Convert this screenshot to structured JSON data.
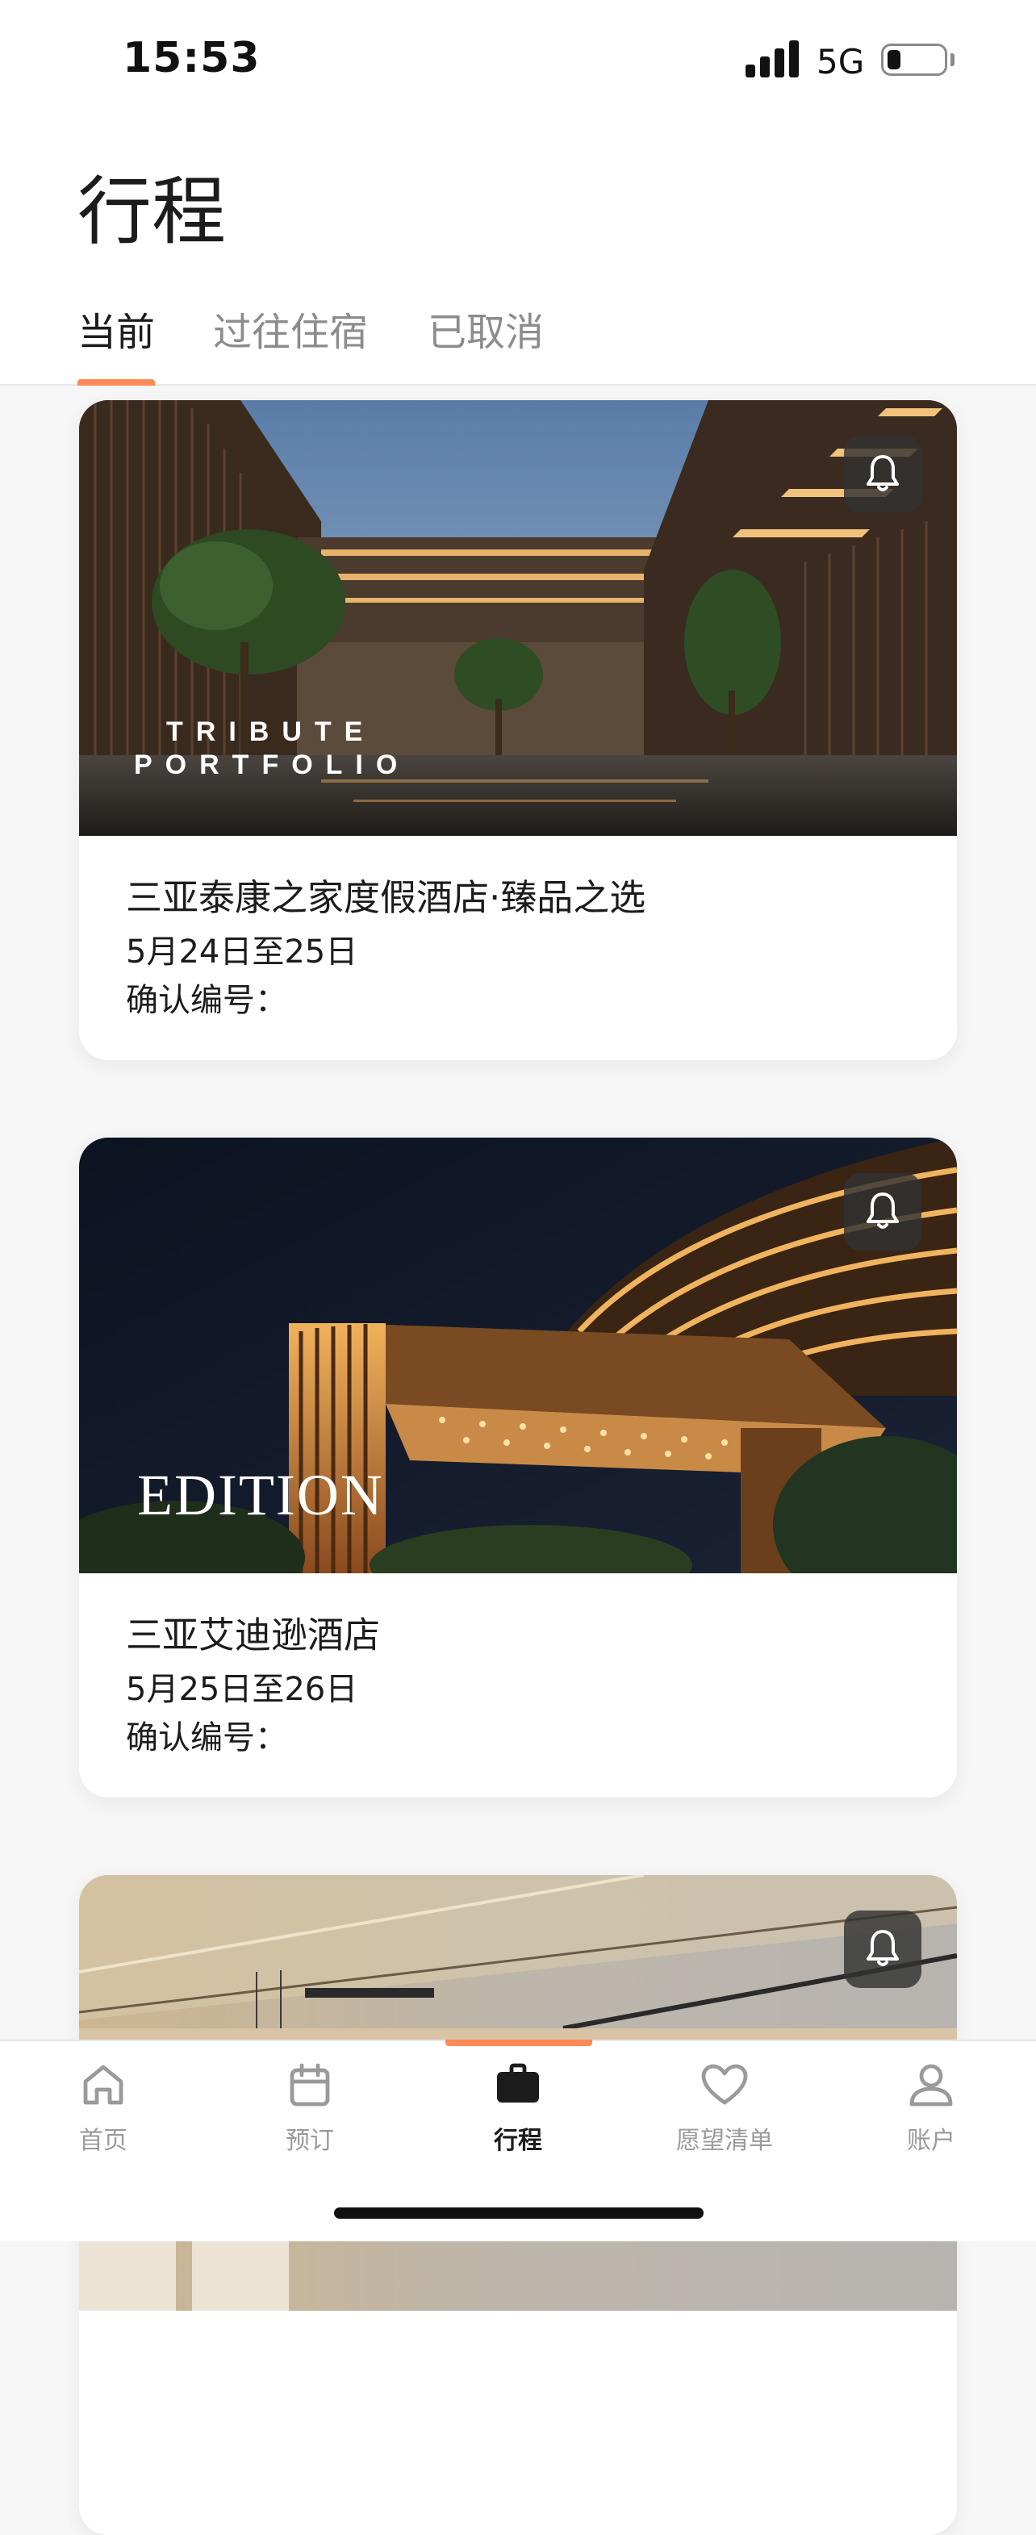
{
  "status_bar": {
    "time": "15:53",
    "network": "5G"
  },
  "header": {
    "title": "行程",
    "tabs": [
      {
        "label": "当前",
        "active": true
      },
      {
        "label": "过往住宿",
        "active": false
      },
      {
        "label": "已取消",
        "active": false
      }
    ]
  },
  "trips": [
    {
      "brand_logo_lines": [
        "TRIBUTE",
        "PORTFOLIO"
      ],
      "hotel_name": "三亚泰康之家度假酒店·臻品之选",
      "dates": "5月24日至25日",
      "confirmation_label": "确认编号："
    },
    {
      "brand_logo_lines": [
        "EDITION"
      ],
      "hotel_name": "三亚艾迪逊酒店",
      "dates": "5月25日至26日",
      "confirmation_label": "确认编号："
    },
    {
      "hotel_name": "",
      "dates": "",
      "confirmation_label": ""
    }
  ],
  "bottom_nav": {
    "items": [
      {
        "label": "首页",
        "icon": "home-icon",
        "active": false
      },
      {
        "label": "预订",
        "icon": "calendar-icon",
        "active": false
      },
      {
        "label": "行程",
        "icon": "briefcase-icon",
        "active": true
      },
      {
        "label": "愿望清单",
        "icon": "heart-icon",
        "active": false
      },
      {
        "label": "账户",
        "icon": "person-icon",
        "active": false
      }
    ]
  },
  "colors": {
    "accent": "#ff8a57",
    "background": "#f6f6f6",
    "card": "#ffffff",
    "text": "#1c1c1c",
    "muted": "#8c8c8c"
  }
}
